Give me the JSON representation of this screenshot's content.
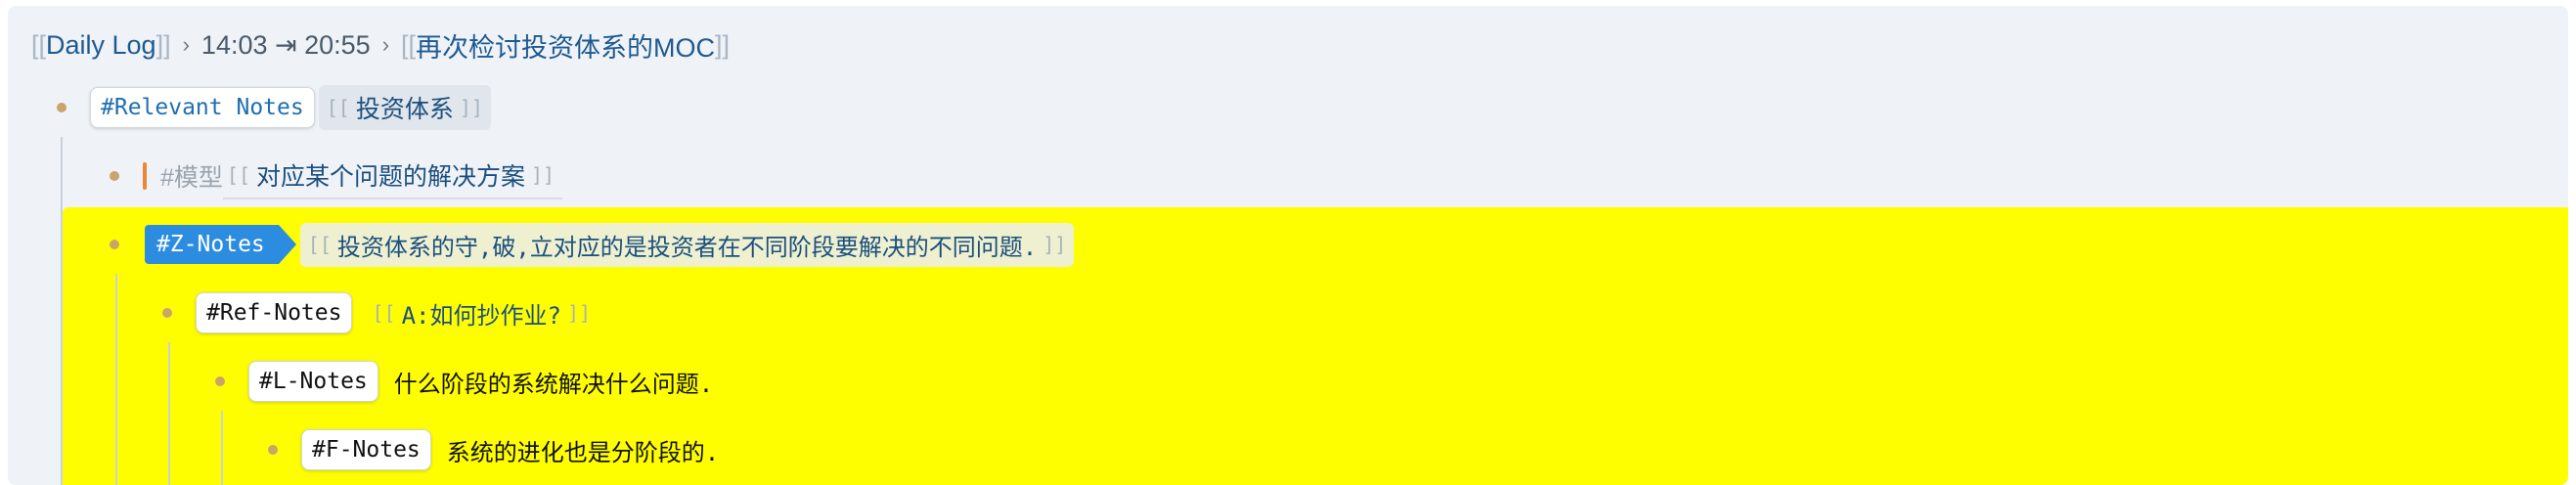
{
  "breadcrumb": {
    "open_bracket": "[[",
    "close_bracket": "]]",
    "page_link": "Daily Log",
    "separator": "›",
    "time_range": "14:03 ⇥ 20:55",
    "block_link": "再次检讨投资体系的MOC"
  },
  "link_brackets": {
    "open": "[[",
    "close": "]]"
  },
  "blocks": {
    "relevant": {
      "tag": "#Relevant Notes",
      "link": "投资体系"
    },
    "model": {
      "tag": "#模型",
      "link": "对应某个问题的解决方案"
    },
    "z_notes": {
      "tag": "#Z-Notes",
      "link": "投资体系的守,破,立对应的是投资者在不同阶段要解决的不同问题."
    },
    "ref_notes": {
      "tag": "#Ref-Notes",
      "link": "A:如何抄作业?"
    },
    "l_notes": {
      "tag": "#L-Notes",
      "text": "什么阶段的系统解决什么问题."
    },
    "f_notes": {
      "tag": "#F-Notes",
      "text": "系统的进化也是分阶段的."
    }
  },
  "colors": {
    "highlight": "#fffe00",
    "z_tag": "#2b8ce0",
    "bullet": "#c9a56a",
    "model_bar": "#e9863a"
  }
}
